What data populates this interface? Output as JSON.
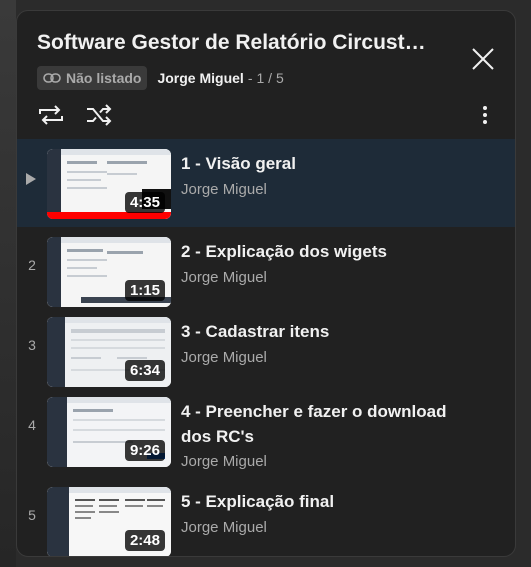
{
  "playlist": {
    "title": "Software Gestor de Relatório Circust…",
    "visibility": "Não listado",
    "owner": "Jorge Miguel",
    "separator": "-",
    "position": "1 / 5"
  },
  "icons": {
    "close": "close-icon",
    "loop": "loop-icon",
    "shuffle": "shuffle-icon",
    "more": "more-vertical-icon",
    "link": "link-icon",
    "play": "play-icon"
  },
  "colors": {
    "panel_bg": "#212121",
    "active_row_bg": "#1e2b38",
    "progress_red": "#ff0000"
  },
  "videos": [
    {
      "index": "",
      "title": "1 - Visão geral",
      "channel": "Jorge Miguel",
      "duration": "4:35",
      "active": true
    },
    {
      "index": "2",
      "title": "2 - Explicação dos wigets",
      "channel": "Jorge Miguel",
      "duration": "1:15"
    },
    {
      "index": "3",
      "title": "3 - Cadastrar itens",
      "channel": "Jorge Miguel",
      "duration": "6:34"
    },
    {
      "index": "4",
      "title": "4 - Preencher e fazer o download dos RC's",
      "channel": "Jorge Miguel",
      "duration": "9:26"
    },
    {
      "index": "5",
      "title": "5 - Explicação final",
      "channel": "Jorge Miguel",
      "duration": "2:48"
    }
  ]
}
